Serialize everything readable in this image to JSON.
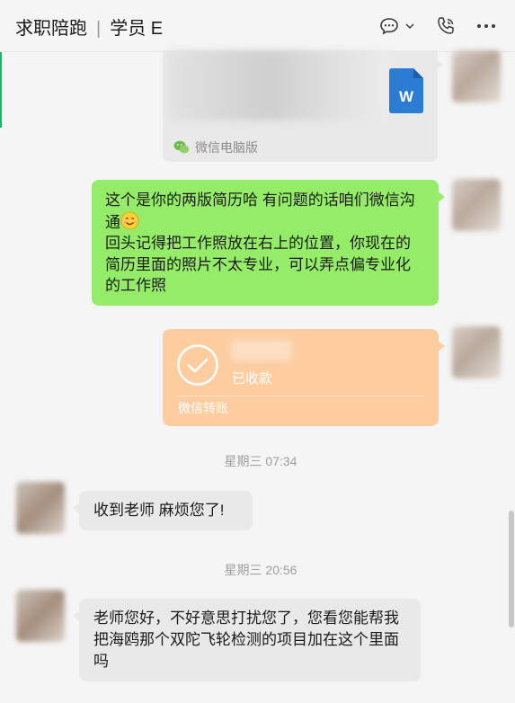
{
  "header": {
    "chat_name": "求职陪跑",
    "separator": "|",
    "member_name": "学员 E"
  },
  "icons": {
    "chat_bubble": "chat-bubble-icon",
    "chevron": "chevron-down-icon",
    "phone": "phone-call-icon",
    "more": "more-options-icon",
    "word": "word-document-icon",
    "wechat": "wechat-logo-icon",
    "check": "check-circle-icon",
    "emoji": "smiling-face-icon"
  },
  "colors": {
    "sent_bubble": "#95ec69",
    "received_bubble": "#e9e9e9",
    "transfer_card": "#fdcda0",
    "accent": "#07c160",
    "word_blue": "#2b7cd3"
  },
  "messages": {
    "file_card": {
      "source": "微信电脑版"
    },
    "sent_text": {
      "lines": [
        "这个是你的两版简历哈 有问题的话咱们微信沟",
        "通",
        "回头记得把工作照放在右上的位置，你现在的",
        "简历里面的照片不太专业，可以弄点偏专业化",
        "的工作照"
      ]
    },
    "transfer": {
      "status": "已收款",
      "label": "微信转账"
    },
    "time1": "星期三 07:34",
    "received1": "收到老师 麻烦您了!",
    "time2": "星期三 20:56",
    "received2": {
      "lines": [
        "老师您好，不好意思打扰您了，您看您能帮我",
        "把海鸥那个双陀飞轮检测的项目加在这个里面",
        "吗"
      ]
    }
  }
}
